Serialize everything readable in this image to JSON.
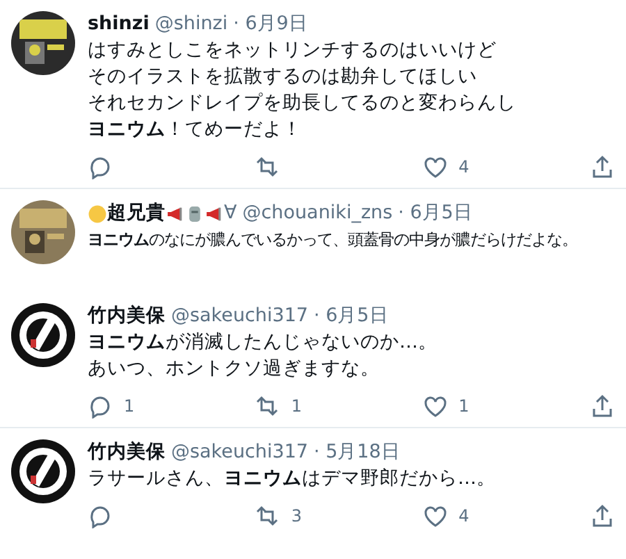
{
  "tweets": [
    {
      "name": "shinzi",
      "handle": "@shinzi",
      "date": "· 6月9日",
      "lines": [
        "はすみとしこをネットリンチするのはいいけど",
        "そのイラストを拡散するのは勘弁してほしい",
        "それセカンドレイプを助長してるのと変わらんし",
        "**ヨニウム**！てめーだよ！"
      ],
      "actions": {
        "like": "4"
      },
      "divider_after": true
    },
    {
      "name": "超兄貴",
      "name_suffix": "∀",
      "handle": "@chouaniki_zns",
      "date": "· 6月5日",
      "icons_before": [
        {
          "kind": "circle"
        }
      ],
      "icons_after": [
        {
          "kind": "megaphone"
        },
        {
          "kind": "statue"
        },
        {
          "kind": "megaphone"
        }
      ],
      "lines": [
        "**ヨニウム**のなにが膿んでいるかって、頭蓋骨の中身が膿だらけだよな。"
      ],
      "divider_after": false
    },
    {
      "name": "竹内美保",
      "handle": "@sakeuchi317",
      "date": "· 6月5日",
      "lines": [
        "**ヨニウム**が消滅したんじゃないのか…。",
        "あいつ、ホントクソ過ぎますな。"
      ],
      "actions": {
        "reply": "1",
        "retweet": "1",
        "like": "1"
      },
      "divider_after": true
    },
    {
      "name": "竹内美保",
      "handle": "@sakeuchi317",
      "date": "· 5月18日",
      "lines": [
        "ラサールさん、**ヨニウム**はデマ野郎だから…。"
      ],
      "actions": {
        "retweet": "3",
        "like": "4"
      },
      "divider_after": false
    }
  ]
}
